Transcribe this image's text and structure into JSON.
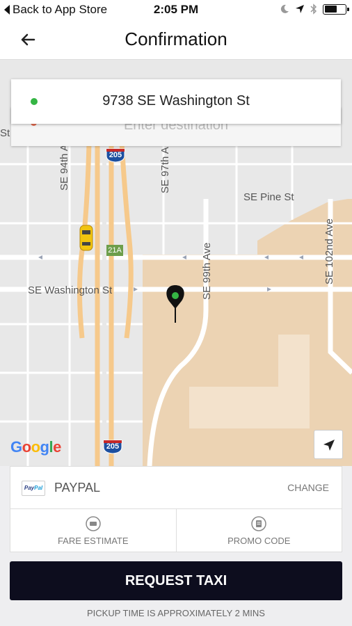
{
  "status_bar": {
    "back_label": "Back to App Store",
    "time": "2:05 PM",
    "icons": [
      "moon-icon",
      "location-arrow-icon",
      "bluetooth-icon",
      "battery-icon"
    ],
    "battery_level": 0.6
  },
  "header": {
    "title": "Confirmation",
    "back_icon": "back-arrow-icon"
  },
  "map": {
    "pickup_address": "9738 SE Washington St",
    "destination_placeholder": "Enter destination",
    "streets": {
      "se_94th": "SE 94th A",
      "se_97th": "SE 97th A",
      "se_pine": "SE Pine St",
      "se_washington": "SE Washington St",
      "se_99th": "SE 99th Ave",
      "se_102nd": "SE 102nd Ave",
      "edge_label": "St"
    },
    "highway_shield": "205",
    "exit_label": "21A",
    "attribution": "Google",
    "colors": {
      "pickup_dot": "#35b544",
      "destination_dot": "#e56b50",
      "highway": "#f6c98b",
      "area": "#ecd3b3"
    }
  },
  "payment": {
    "logo_text_a": "Pay",
    "logo_text_b": "Pal",
    "method": "PAYPAL",
    "change_label": "CHANGE"
  },
  "options": {
    "fare_estimate": "FARE ESTIMATE",
    "promo_code": "PROMO CODE"
  },
  "request": {
    "button_label": "REQUEST TAXI",
    "pickup_time": "PICKUP TIME IS APPROXIMATELY 2 MINS"
  }
}
